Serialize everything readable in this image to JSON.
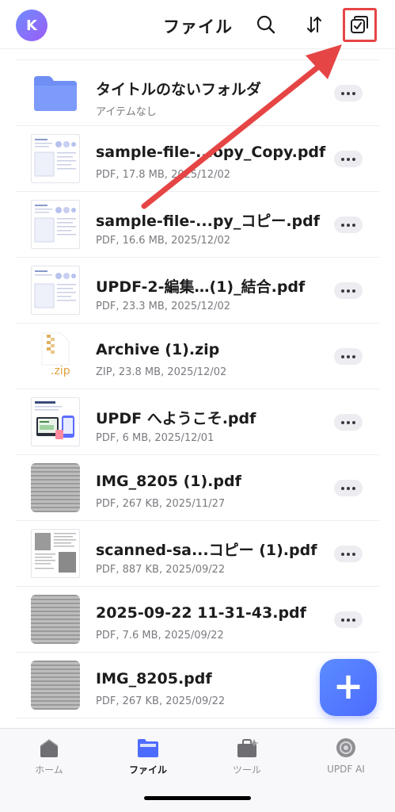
{
  "header": {
    "avatar_initial": "K",
    "title": "ファイル"
  },
  "files": [
    {
      "name": "タイトルのないフォルダ",
      "meta": "アイテムなし",
      "kind": "folder"
    },
    {
      "name": "sample-file-...opy_Copy.pdf",
      "meta": "PDF, 17.8 MB, 2025/12/02",
      "kind": "pdf-page"
    },
    {
      "name": "sample-file-...py_コピー.pdf",
      "meta": "PDF, 16.6 MB, 2025/12/02",
      "kind": "pdf-page"
    },
    {
      "name": " UPDF-2-編集…(1)_結合.pdf",
      "meta": "PDF, 23.3 MB, 2025/12/02",
      "kind": "pdf-page"
    },
    {
      "name": "Archive (1).zip",
      "meta": "ZIP, 23.8 MB, 2025/12/02",
      "kind": "zip",
      "thumb_label": ".zip"
    },
    {
      "name": "UPDF へようこそ.pdf",
      "meta": "PDF, 6 MB, 2025/12/01",
      "kind": "pdf-welcome"
    },
    {
      "name": "IMG_8205 (1).pdf",
      "meta": "PDF, 267 KB, 2025/11/27",
      "kind": "scan"
    },
    {
      "name": " scanned-sa...コピー (1).pdf",
      "meta": "PDF, 887 KB, 2025/09/22",
      "kind": "pdf-scan-doc"
    },
    {
      "name": "2025-09-22 11-31-43.pdf",
      "meta": "PDF, 7.6 MB, 2025/09/22",
      "kind": "scan"
    },
    {
      "name": "IMG_8205.pdf",
      "meta": "PDF, 267 KB, 2025/09/22",
      "kind": "scan"
    }
  ],
  "fab": {
    "label": "+"
  },
  "tabs": [
    {
      "label": "ホーム",
      "icon": "home-icon"
    },
    {
      "label": "ファイル",
      "icon": "folder-icon",
      "active": true
    },
    {
      "label": "ツール",
      "icon": "toolbox-icon"
    },
    {
      "label": "UPDF AI",
      "icon": "ai-icon"
    }
  ],
  "colors": {
    "accent": "#4d6bff",
    "highlight": "#e64545",
    "folder": "#6f8ff5",
    "zip": "#e0b060"
  }
}
